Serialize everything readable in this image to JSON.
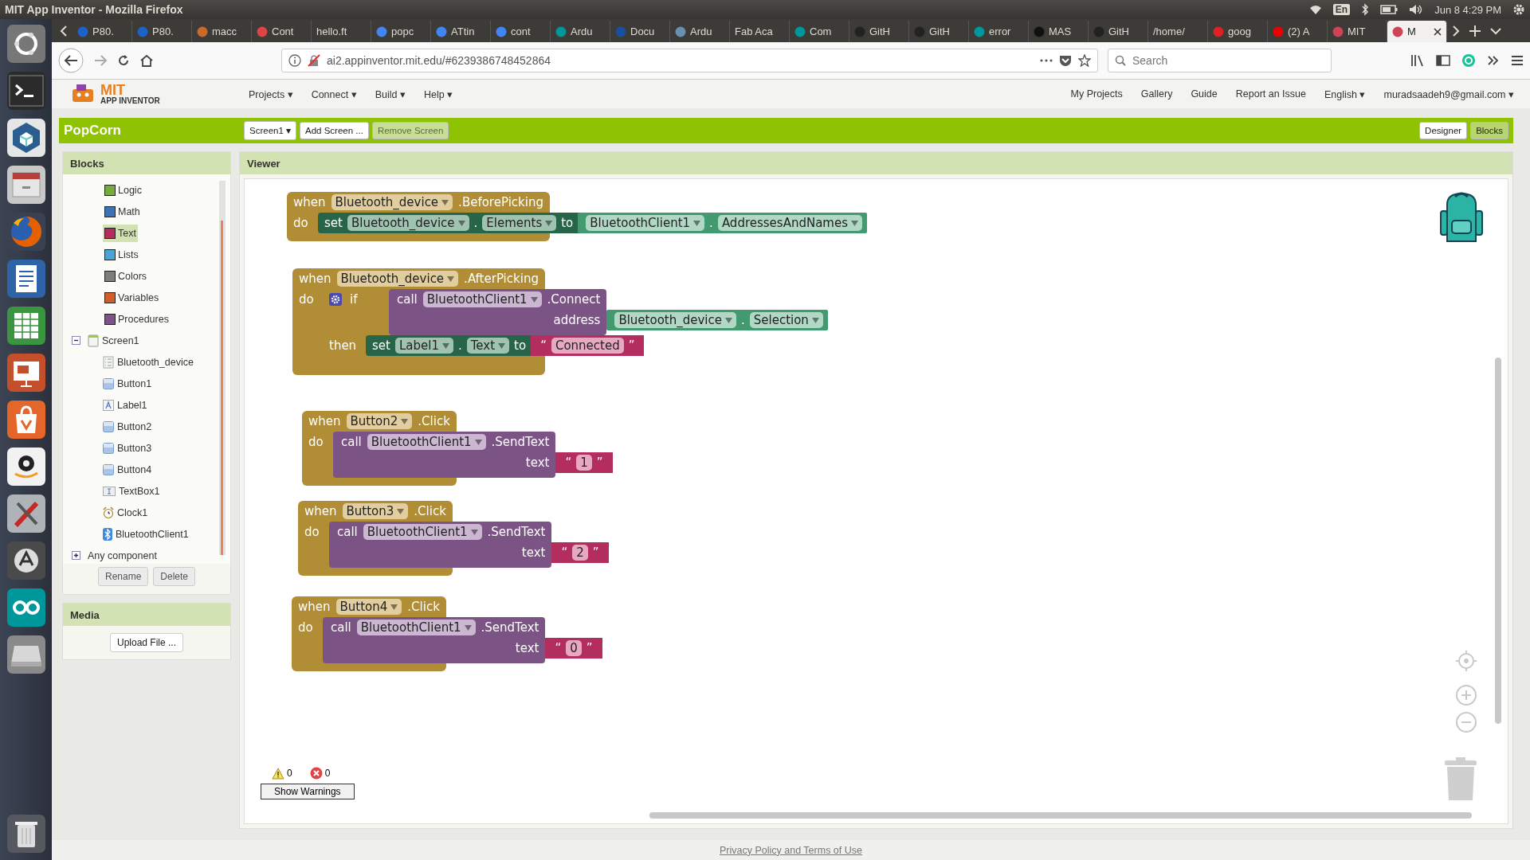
{
  "system_bar": {
    "title": "MIT App Inventor - Mozilla Firefox",
    "keyboard": "En",
    "clock": "Jun 8  4:29 PM"
  },
  "browser": {
    "tabs": [
      {
        "label": "P80.",
        "selected": false
      },
      {
        "label": "P80.",
        "selected": false
      },
      {
        "label": "macc",
        "selected": false
      },
      {
        "label": "Cont",
        "selected": false
      },
      {
        "label": "hello.ft",
        "selected": false
      },
      {
        "label": "popc",
        "selected": false
      },
      {
        "label": "ATtin",
        "selected": false
      },
      {
        "label": "cont",
        "selected": false
      },
      {
        "label": "Ardu",
        "selected": false
      },
      {
        "label": "Docu",
        "selected": false
      },
      {
        "label": "Ardu",
        "selected": false
      },
      {
        "label": "Fab Aca",
        "selected": false
      },
      {
        "label": "Com",
        "selected": false
      },
      {
        "label": "GitH",
        "selected": false
      },
      {
        "label": "GitH",
        "selected": false
      },
      {
        "label": "error",
        "selected": false
      },
      {
        "label": "MAS",
        "selected": false
      },
      {
        "label": "GitH",
        "selected": false
      },
      {
        "label": "/home/",
        "selected": false
      },
      {
        "label": "goog",
        "selected": false
      },
      {
        "label": "(2) A",
        "selected": false
      },
      {
        "label": "MIT",
        "selected": false
      },
      {
        "label": "M",
        "selected": true
      }
    ],
    "url": "ai2.appinventor.mit.edu/#6239386748452864",
    "search": {
      "placeholder": "Search"
    }
  },
  "app": {
    "logo": {
      "title": "MIT",
      "subtitle": "APP INVENTOR"
    },
    "menus": [
      "Projects ▾",
      "Connect ▾",
      "Build ▾",
      "Help ▾"
    ],
    "links": [
      "My Projects",
      "Gallery",
      "Guide",
      "Report an Issue",
      "English ▾",
      "muradsaadeh9@gmail.com ▾"
    ]
  },
  "project": {
    "name": "PopCorn",
    "screen": "Screen1 ▾",
    "add_screen": "Add Screen ...",
    "remove_screen": {
      "label": "Remove Screen",
      "disabled": true
    },
    "views": [
      {
        "label": "Designer",
        "selected": false
      },
      {
        "label": "Blocks",
        "selected": true
      }
    ]
  },
  "blocks_panel": {
    "title": "Blocks",
    "builtins": [
      {
        "label": "Logic",
        "color": "#77ab41",
        "selected": false
      },
      {
        "label": "Math",
        "color": "#3f71b5",
        "selected": false
      },
      {
        "label": "Text",
        "color": "#b32d5e",
        "selected": true
      },
      {
        "label": "Lists",
        "color": "#49a6d4",
        "selected": false
      },
      {
        "label": "Colors",
        "color": "#7d7d7d",
        "selected": false
      },
      {
        "label": "Variables",
        "color": "#d05f2d",
        "selected": false
      },
      {
        "label": "Procedures",
        "color": "#7c5385",
        "selected": false
      }
    ],
    "tree": [
      {
        "label": "Screen1",
        "kind": "screen",
        "expanded": true,
        "children": [
          {
            "label": "Bluetooth_device",
            "kind": "listpicker"
          },
          {
            "label": "Button1",
            "kind": "button"
          },
          {
            "label": "Label1",
            "kind": "label"
          },
          {
            "label": "Button2",
            "kind": "button"
          },
          {
            "label": "Button3",
            "kind": "button"
          },
          {
            "label": "Button4",
            "kind": "button"
          },
          {
            "label": "TextBox1",
            "kind": "textbox"
          },
          {
            "label": "Clock1",
            "kind": "clock"
          },
          {
            "label": "BluetoothClient1",
            "kind": "bluetooth"
          }
        ]
      },
      {
        "label": "Any component",
        "kind": "group",
        "expanded": false
      }
    ],
    "buttons": [
      "Rename",
      "Delete"
    ]
  },
  "media_panel": {
    "title": "Media",
    "button": "Upload File ..."
  },
  "viewer": {
    "title": "Viewer",
    "blocks": [
      {
        "kind": "event",
        "keyword": "when",
        "component": "Bluetooth_device",
        "event": ".BeforePicking",
        "do": "do",
        "body": [
          {
            "kind": "set",
            "keyword": "set",
            "component": "Bluetooth_device",
            "dot": ".",
            "property": "Elements",
            "to": "to",
            "value": {
              "kind": "get",
              "component": "BluetoothClient1",
              "dot": ".",
              "property": "AddressesAndNames"
            }
          }
        ]
      },
      {
        "kind": "event",
        "keyword": "when",
        "component": "Bluetooth_device",
        "event": ".AfterPicking",
        "do": "do",
        "body": [
          {
            "kind": "if",
            "keyword": "if",
            "then": "then",
            "condition": {
              "kind": "call",
              "keyword": "call",
              "component": "BluetoothClient1",
              "method": ".Connect",
              "args": [
                {
                  "name": "address",
                  "value": {
                    "kind": "get",
                    "component": "Bluetooth_device",
                    "dot": ".",
                    "property": "Selection"
                  }
                }
              ]
            },
            "body": [
              {
                "kind": "set",
                "keyword": "set",
                "component": "Label1",
                "dot": ".",
                "property": "Text",
                "to": "to",
                "value": {
                  "kind": "text",
                  "open": "“",
                  "text": "Connected",
                  "close": "”"
                }
              }
            ]
          }
        ]
      },
      {
        "kind": "event",
        "keyword": "when",
        "component": "Button2",
        "event": ".Click",
        "do": "do",
        "body": [
          {
            "kind": "call",
            "keyword": "call",
            "component": "BluetoothClient1",
            "method": ".SendText",
            "args": [
              {
                "name": "text",
                "value": {
                  "kind": "text",
                  "open": "“",
                  "text": "1",
                  "close": "”"
                }
              }
            ]
          }
        ]
      },
      {
        "kind": "event",
        "keyword": "when",
        "component": "Button3",
        "event": ".Click",
        "do": "do",
        "body": [
          {
            "kind": "call",
            "keyword": "call",
            "component": "BluetoothClient1",
            "method": ".SendText",
            "args": [
              {
                "name": "text",
                "value": {
                  "kind": "text",
                  "open": "“",
                  "text": "2",
                  "close": "”"
                }
              }
            ]
          }
        ]
      },
      {
        "kind": "event",
        "keyword": "when",
        "component": "Button4",
        "event": ".Click",
        "do": "do",
        "body": [
          {
            "kind": "call",
            "keyword": "call",
            "component": "BluetoothClient1",
            "method": ".SendText",
            "args": [
              {
                "name": "text",
                "value": {
                  "kind": "text",
                  "open": "“",
                  "text": "0",
                  "close": "”"
                }
              }
            ]
          }
        ]
      }
    ],
    "warnings": {
      "warning_count": "0",
      "error_count": "0",
      "button": "Show Warnings"
    }
  },
  "footer": {
    "link": "Privacy Policy and Terms of Use"
  }
}
